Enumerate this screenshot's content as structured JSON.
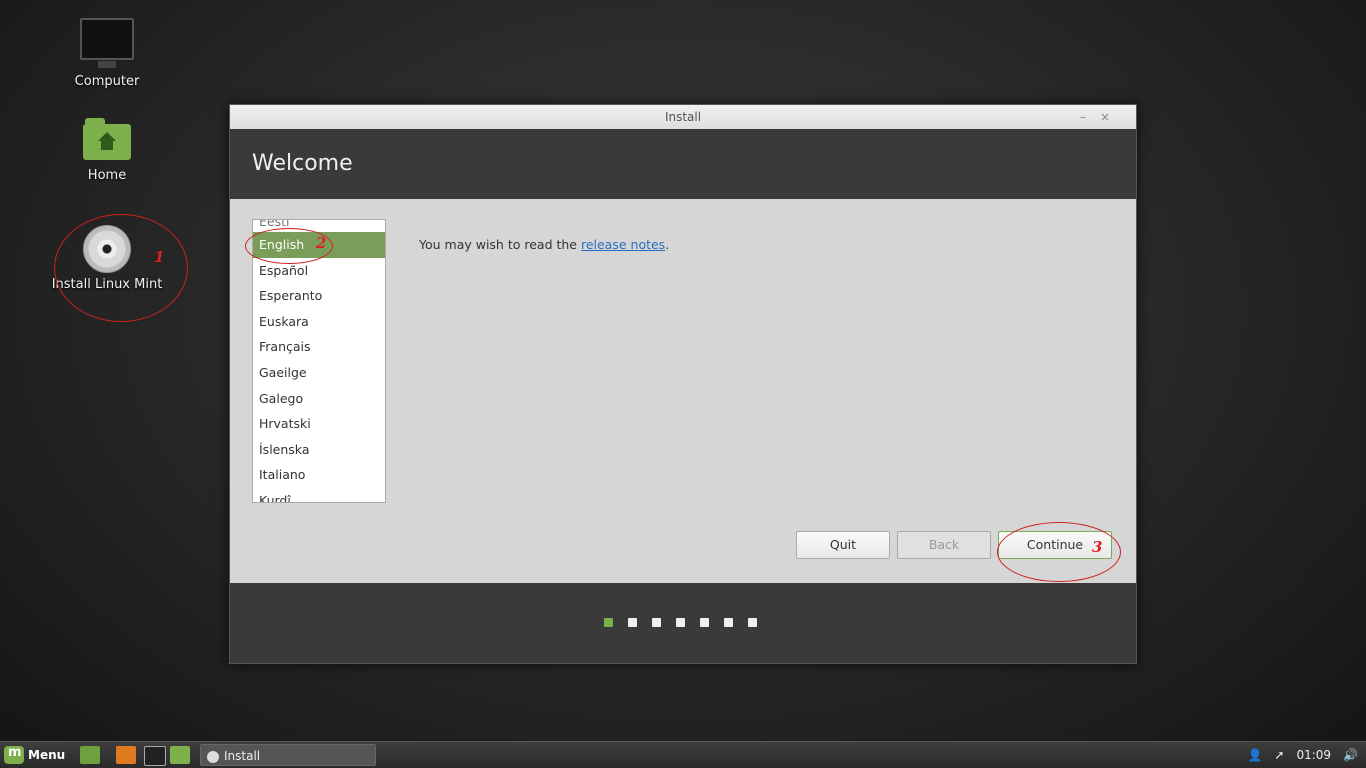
{
  "desktop": {
    "icons": [
      {
        "label": "Computer"
      },
      {
        "label": "Home"
      },
      {
        "label": "Install Linux Mint"
      }
    ]
  },
  "annotations": [
    "1",
    "2",
    "3"
  ],
  "window": {
    "title": "Install",
    "controls": [
      "–",
      "×"
    ],
    "header_title": "Welcome",
    "languages": [
      "Eesti",
      "English",
      "Español",
      "Esperanto",
      "Euskara",
      "Français",
      "Gaeilge",
      "Galego",
      "Hrvatski",
      "Íslenska",
      "Italiano",
      "Kurdî"
    ],
    "selected_language": "English",
    "welcome_text_prefix": "You may wish to read the ",
    "welcome_link": "release notes",
    "welcome_text_suffix": ".",
    "buttons": {
      "quit": "Quit",
      "back": "Back",
      "continue": "Continue"
    },
    "progress": {
      "total_steps": 7,
      "current_step": 1
    }
  },
  "taskbar": {
    "menu_label": "Menu",
    "task_label": "Install",
    "clock": "01:09"
  },
  "colors": {
    "accent": "#7db04a",
    "selection": "#7a9e5a",
    "annotation": "#d02020",
    "link": "#2a6fc0"
  }
}
